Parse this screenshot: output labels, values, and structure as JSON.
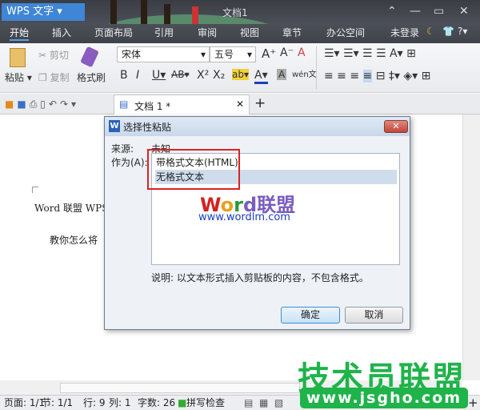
{
  "app": {
    "menu_label": "WPS 文字",
    "title": "文档1"
  },
  "tabs": [
    {
      "label": "开始",
      "active": true
    },
    {
      "label": "插入"
    },
    {
      "label": "页面布局"
    },
    {
      "label": "引用"
    },
    {
      "label": "审阅"
    },
    {
      "label": "视图"
    },
    {
      "label": "章节"
    },
    {
      "label": "办公空间"
    }
  ],
  "account": {
    "login": "未登录"
  },
  "ribbon": {
    "paste": "粘贴",
    "cut": "剪切",
    "copy": "复制",
    "format_painter": "格式刷",
    "font": "宋体",
    "size": "五号"
  },
  "doc_tab": {
    "label": "文档 1 *"
  },
  "document": {
    "line1": "Word 联盟 WPS",
    "line2": "教你怎么将"
  },
  "dialog": {
    "title": "选择性粘贴",
    "source_label": "来源:",
    "source_value": "未知",
    "as_label": "作为(A):",
    "options": [
      {
        "label": "带格式文本(HTML)",
        "selected": false
      },
      {
        "label": "无格式文本",
        "selected": true
      }
    ],
    "preview_logo": "Word联盟",
    "preview_url": "www.wordlm.com",
    "description": "说明: 以文本形式插入剪贴板的内容，不包含格式。",
    "ok": "确定",
    "cancel": "取消"
  },
  "status": {
    "page": "页面: 1/1",
    "section": "节: 1/1",
    "row": "行: 9",
    "col": "列: 1",
    "words": "字数: 26",
    "spell": "拼写检查"
  },
  "watermark": {
    "text": "技术员联盟",
    "url": "www.jsgho.com"
  },
  "colors": {
    "accent": "#3f86d6",
    "highlight": "#d22222",
    "watermark": "#1fb34a"
  }
}
